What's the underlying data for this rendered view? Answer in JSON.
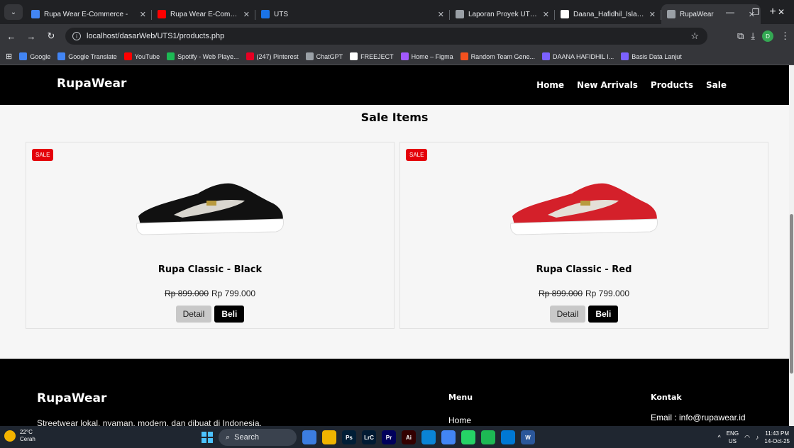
{
  "browser": {
    "tabs": [
      {
        "label": "Rupa Wear E-Commerce -",
        "favicon_color": "#4285f4",
        "active": false
      },
      {
        "label": "Rupa Wear E-Commerce",
        "favicon_color": "#ff0000",
        "active": false
      },
      {
        "label": "UTS",
        "favicon_color": "#1a73e8",
        "active": false
      },
      {
        "label": "Laporan Proyek UTS.docx",
        "favicon_color": "#9aa0a6",
        "active": false
      },
      {
        "label": "Daana_Hafidhil_Islam_DES",
        "favicon_color": "#ffffff",
        "active": false
      },
      {
        "label": "RupaWear",
        "favicon_color": "#9aa0a6",
        "active": true
      }
    ],
    "url": "localhost/dasarWeb/UTS1/products.php",
    "profile_initial": "D",
    "bookmarks": [
      {
        "label": "Google",
        "color": "#4285f4"
      },
      {
        "label": "Google Translate",
        "color": "#4285f4"
      },
      {
        "label": "YouTube",
        "color": "#ff0000"
      },
      {
        "label": "Spotify - Web Playe...",
        "color": "#1db954"
      },
      {
        "label": "(247) Pinterest",
        "color": "#e60023"
      },
      {
        "label": "ChatGPT",
        "color": "#9aa0a6"
      },
      {
        "label": "FREEJECT",
        "color": "#ffffff"
      },
      {
        "label": "Home – Figma",
        "color": "#a259ff"
      },
      {
        "label": "Random Team Gene...",
        "color": "#f4511e"
      },
      {
        "label": "DAANA HAFIDHIL I...",
        "color": "#7b61ff"
      },
      {
        "label": "Basis Data Lanjut",
        "color": "#7b61ff"
      }
    ]
  },
  "site": {
    "brand": "RupaWear",
    "nav": [
      "Home",
      "New Arrivals",
      "Products",
      "Sale"
    ],
    "section_title": "Sale Items",
    "products": [
      {
        "badge": "SALE",
        "name": "Rupa Classic - Black",
        "old_price": "Rp 899.000",
        "price": "Rp 799.000",
        "detail_label": "Detail",
        "buy_label": "Beli",
        "shoe_color": "#111111"
      },
      {
        "badge": "SALE",
        "name": "Rupa Classic - Red",
        "old_price": "Rp 899.000",
        "price": "Rp 799.000",
        "detail_label": "Detail",
        "buy_label": "Beli",
        "shoe_color": "#d4202a"
      }
    ],
    "footer": {
      "brand": "RupaWear",
      "tagline": "Streetwear lokal, nyaman, modern, dan dibuat di Indonesia.",
      "menu_heading": "Menu",
      "menu_first": "Home",
      "contact_heading": "Kontak",
      "email": "Email : info@rupawear.id"
    }
  },
  "taskbar": {
    "temp": "22°C",
    "condition": "Cerah",
    "search_label": "Search",
    "apps": [
      {
        "label": "",
        "color": "#3c7de0"
      },
      {
        "label": "",
        "color": "#f0b400"
      },
      {
        "label": "Ps",
        "color": "#001e36"
      },
      {
        "label": "LrC",
        "color": "#001a33"
      },
      {
        "label": "Pr",
        "color": "#00005b"
      },
      {
        "label": "Ai",
        "color": "#330000"
      },
      {
        "label": "",
        "color": "#0a84d6"
      },
      {
        "label": "",
        "color": "#4285f4"
      },
      {
        "label": "",
        "color": "#25d366"
      },
      {
        "label": "",
        "color": "#1db954"
      },
      {
        "label": "",
        "color": "#0078d4"
      },
      {
        "label": "W",
        "color": "#2b579a"
      }
    ],
    "lang": "ENG",
    "region": "US",
    "time": "11:43 PM",
    "date": "14-Oct-25"
  }
}
